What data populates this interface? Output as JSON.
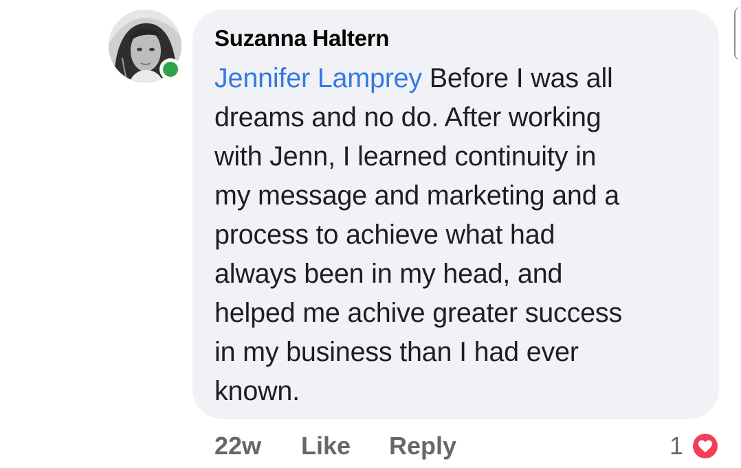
{
  "colors": {
    "bubble_bg": "#f0f2f5",
    "author_text": "#050505",
    "body_text": "#1c1e21",
    "mention_text": "#3578e5",
    "action_text": "#65676b",
    "presence": "#31a24c",
    "love_reaction": "#f33e58"
  },
  "comment": {
    "author": "Suzanna Haltern",
    "mention": "Jennifer Lamprey",
    "lines": [
      " Before I was all",
      "dreams and no do. After working",
      "with Jenn, I learned continuity in",
      "my message and marketing and a",
      "process to achieve what had",
      "always been in my head, and",
      "helped me achive greater success",
      "in my business than I had ever",
      "known."
    ]
  },
  "actions": {
    "time": "22w",
    "like": "Like",
    "reply": "Reply"
  },
  "reactions": {
    "count": "1",
    "icon": "love-reaction-icon"
  },
  "avatar": {
    "icon": "profile-photo",
    "online": true
  }
}
